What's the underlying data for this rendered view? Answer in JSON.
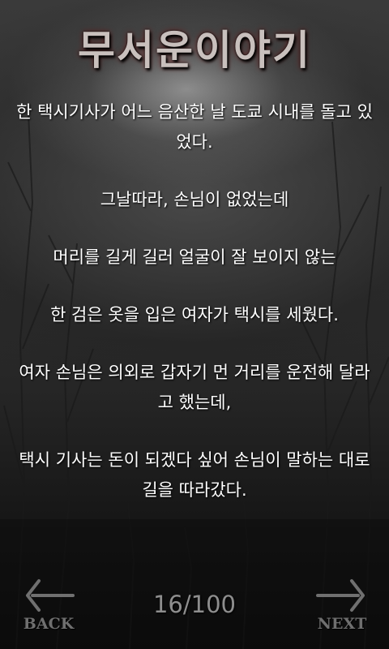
{
  "header": {
    "title": "무서운이야기"
  },
  "story": {
    "paragraphs": [
      "한 택시기사가 어느 음산한 날 도쿄 시내를 돌고 있었다.",
      "그날따라, 손님이 없었는데",
      "머리를 길게 길러 얼굴이 잘 보이지 않는",
      "한 검은 옷을 입은 여자가 택시를 세웠다.",
      "여자 손님은 의외로 갑자기 먼 거리를 운전해 달라고 했는데,",
      "택시 기사는 돈이 되겠다 싶어 손님이 말하는 대로 길을 따라갔다."
    ]
  },
  "nav": {
    "back_label": "BACK",
    "next_label": "NEXT",
    "page_counter": "16/100"
  },
  "icons": {
    "back": "left-arrow-icon",
    "next": "right-arrow-icon"
  },
  "colors": {
    "text": "#ffffff",
    "title": "#c9c0bd",
    "nav": "#6f6f6f"
  }
}
